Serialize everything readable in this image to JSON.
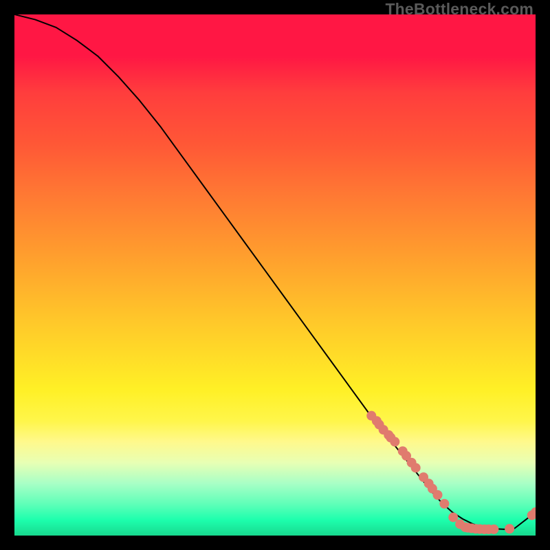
{
  "watermark": "TheBottleneck.com",
  "chart_data": {
    "type": "line",
    "title": "",
    "xlabel": "",
    "ylabel": "",
    "xlim": [
      0,
      100
    ],
    "ylim": [
      0,
      100
    ],
    "curve": {
      "name": "main-curve",
      "x": [
        0,
        4,
        8,
        12,
        16,
        20,
        24,
        28,
        32,
        36,
        40,
        44,
        48,
        52,
        56,
        60,
        64,
        68,
        72,
        76,
        80,
        82,
        84,
        86,
        88,
        90,
        92,
        94,
        96,
        100
      ],
      "y": [
        100,
        99,
        97.5,
        95,
        92,
        88,
        83.5,
        78.5,
        73,
        67.5,
        62,
        56.5,
        51,
        45.5,
        40,
        34.5,
        29,
        23.5,
        18.5,
        13.5,
        8.5,
        6.3,
        4.5,
        3.2,
        2.2,
        1.6,
        1.3,
        1.2,
        1.4,
        4.5
      ]
    },
    "dots": {
      "name": "gpu-points",
      "color": "#e07b6e",
      "radius_px": 7,
      "points": [
        {
          "x": 68.5,
          "y": 23.0
        },
        {
          "x": 69.5,
          "y": 22.0
        },
        {
          "x": 70.0,
          "y": 21.3
        },
        {
          "x": 70.8,
          "y": 20.3
        },
        {
          "x": 71.8,
          "y": 19.3
        },
        {
          "x": 72.2,
          "y": 18.8
        },
        {
          "x": 73.0,
          "y": 18.0
        },
        {
          "x": 74.5,
          "y": 16.2
        },
        {
          "x": 75.2,
          "y": 15.3
        },
        {
          "x": 76.2,
          "y": 14.0
        },
        {
          "x": 77.0,
          "y": 13.0
        },
        {
          "x": 78.5,
          "y": 11.2
        },
        {
          "x": 79.5,
          "y": 10.0
        },
        {
          "x": 80.2,
          "y": 9.0
        },
        {
          "x": 81.2,
          "y": 7.8
        },
        {
          "x": 82.5,
          "y": 6.1
        },
        {
          "x": 84.2,
          "y": 3.5
        },
        {
          "x": 85.5,
          "y": 2.2
        },
        {
          "x": 86.5,
          "y": 1.6
        },
        {
          "x": 87.0,
          "y": 1.5
        },
        {
          "x": 87.7,
          "y": 1.4
        },
        {
          "x": 88.5,
          "y": 1.3
        },
        {
          "x": 89.3,
          "y": 1.25
        },
        {
          "x": 90.2,
          "y": 1.2
        },
        {
          "x": 91.0,
          "y": 1.2
        },
        {
          "x": 92.0,
          "y": 1.2
        },
        {
          "x": 95.0,
          "y": 1.3
        },
        {
          "x": 99.3,
          "y": 3.9
        },
        {
          "x": 100.0,
          "y": 4.5
        }
      ]
    }
  }
}
